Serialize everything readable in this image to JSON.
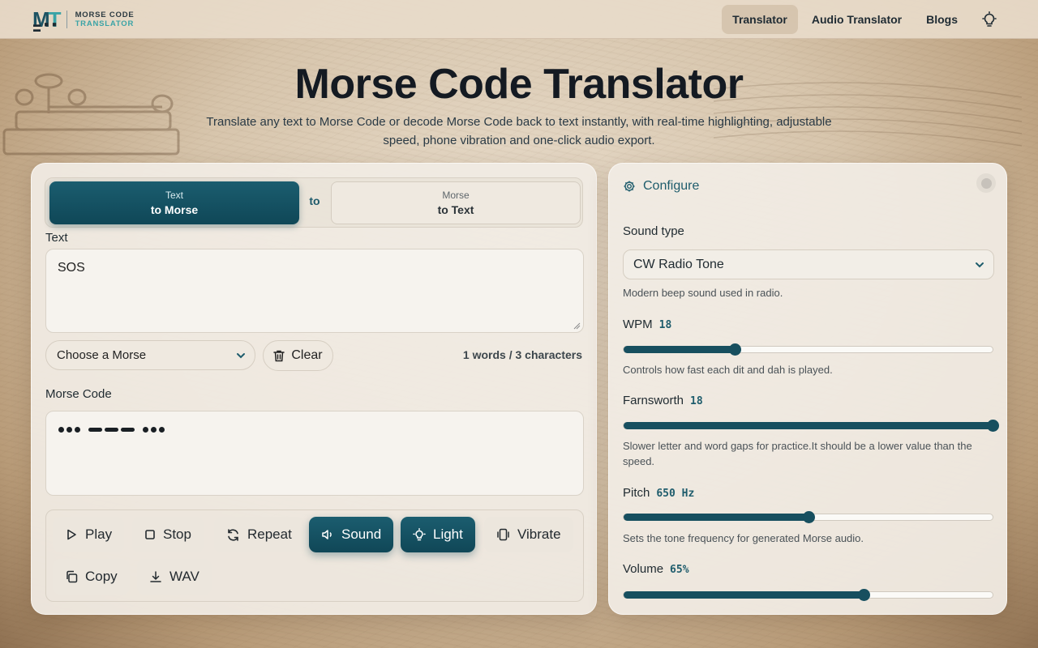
{
  "header": {
    "logo_mark_m": "M",
    "logo_mark_t": "T",
    "logo_dots": "▬ ■ ■ ▬",
    "logo_line1": "MORSE CODE",
    "logo_line2": "TRANSLATOR",
    "nav": [
      {
        "label": "Translator",
        "active": true
      },
      {
        "label": "Audio Translator",
        "active": false
      },
      {
        "label": "Blogs",
        "active": false
      }
    ],
    "theme_icon": "lightbulb-icon"
  },
  "hero": {
    "title": "Morse Code Translator",
    "subtitle": "Translate any text to Morse Code or decode Morse Code back to text instantly, with real-time highlighting, adjustable speed, phone vibration and one-click audio export."
  },
  "translator": {
    "mode_left": {
      "small": "Text",
      "big": "to Morse"
    },
    "mode_to": "to",
    "mode_right": {
      "small": "Morse",
      "big": "to Text"
    },
    "text_label": "Text",
    "text_value": "SOS",
    "morse_select": "Choose a Morse",
    "clear_label": "Clear",
    "count": "1 words / 3 characters",
    "morse_label": "Morse Code",
    "morse_value": "... --- ...",
    "controls": {
      "play": "Play",
      "stop": "Stop",
      "repeat": "Repeat",
      "sound": "Sound",
      "light": "Light",
      "vibrate": "Vibrate",
      "copy": "Copy",
      "wav": "WAV"
    },
    "toggles": {
      "sound": true,
      "light": true
    }
  },
  "config": {
    "title": "Configure",
    "sound_type_label": "Sound type",
    "sound_type_value": "CW Radio Tone",
    "sound_type_help": "Modern beep sound used in radio.",
    "wpm": {
      "label": "WPM",
      "value": "18",
      "level": 0.3,
      "help": "Controls how fast each dit and dah is played."
    },
    "farnsworth": {
      "label": "Farnsworth",
      "value": "18",
      "level": 1.0,
      "help": "Slower letter and word gaps for practice.It should be a lower value than the speed."
    },
    "pitch": {
      "label": "Pitch",
      "value": "650 Hz",
      "level": 0.5,
      "help": "Sets the tone frequency for generated Morse audio."
    },
    "volume": {
      "label": "Volume",
      "value": "65%",
      "level": 0.65
    }
  },
  "colors": {
    "accent": "#174f5f",
    "accent_light": "#3aa3a6",
    "panel": "#f1ece4"
  }
}
